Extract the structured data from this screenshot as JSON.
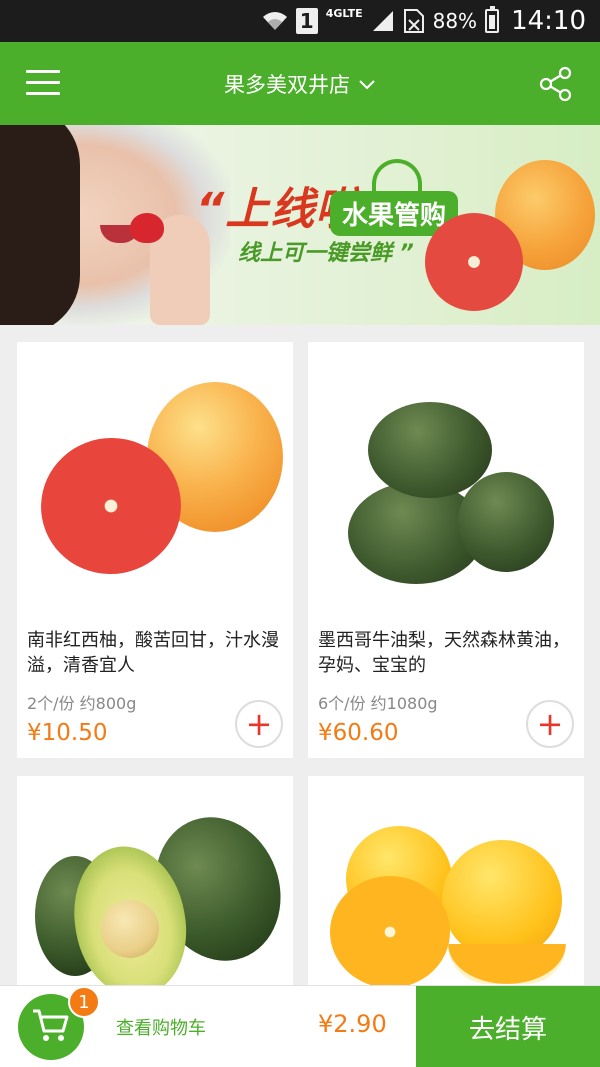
{
  "status_bar": {
    "sim_slot": "1",
    "network": "4GLTE",
    "battery": "88%",
    "time": "14:10"
  },
  "header": {
    "store_name": "果多美双井店",
    "chevron": "∨"
  },
  "banner": {
    "title": "“上线啦",
    "badge": "水果管购",
    "subtitle": "线上可一键尝鲜 ”"
  },
  "products": [
    {
      "name": "南非红西柚，酸苦回甘，汁水漫溢，清香宜人",
      "spec": "2个/份 约800g",
      "price": "¥10.50",
      "image": "grapefruit"
    },
    {
      "name": "墨西哥牛油梨，天然森林黄油，孕妈、宝宝的",
      "spec": "6个/份 约1080g",
      "price": "¥60.60",
      "image": "avocado-pile"
    },
    {
      "image": "avocado-halved"
    },
    {
      "image": "oranges"
    }
  ],
  "add_label": "+",
  "bottom_bar": {
    "cart_count": "1",
    "view_cart_label": "查看购物车",
    "total": "¥2.90",
    "checkout_label": "去结算"
  },
  "colors": {
    "brand_green": "#4caf2b",
    "price_orange": "#f47a13",
    "add_red": "#e8362a"
  }
}
